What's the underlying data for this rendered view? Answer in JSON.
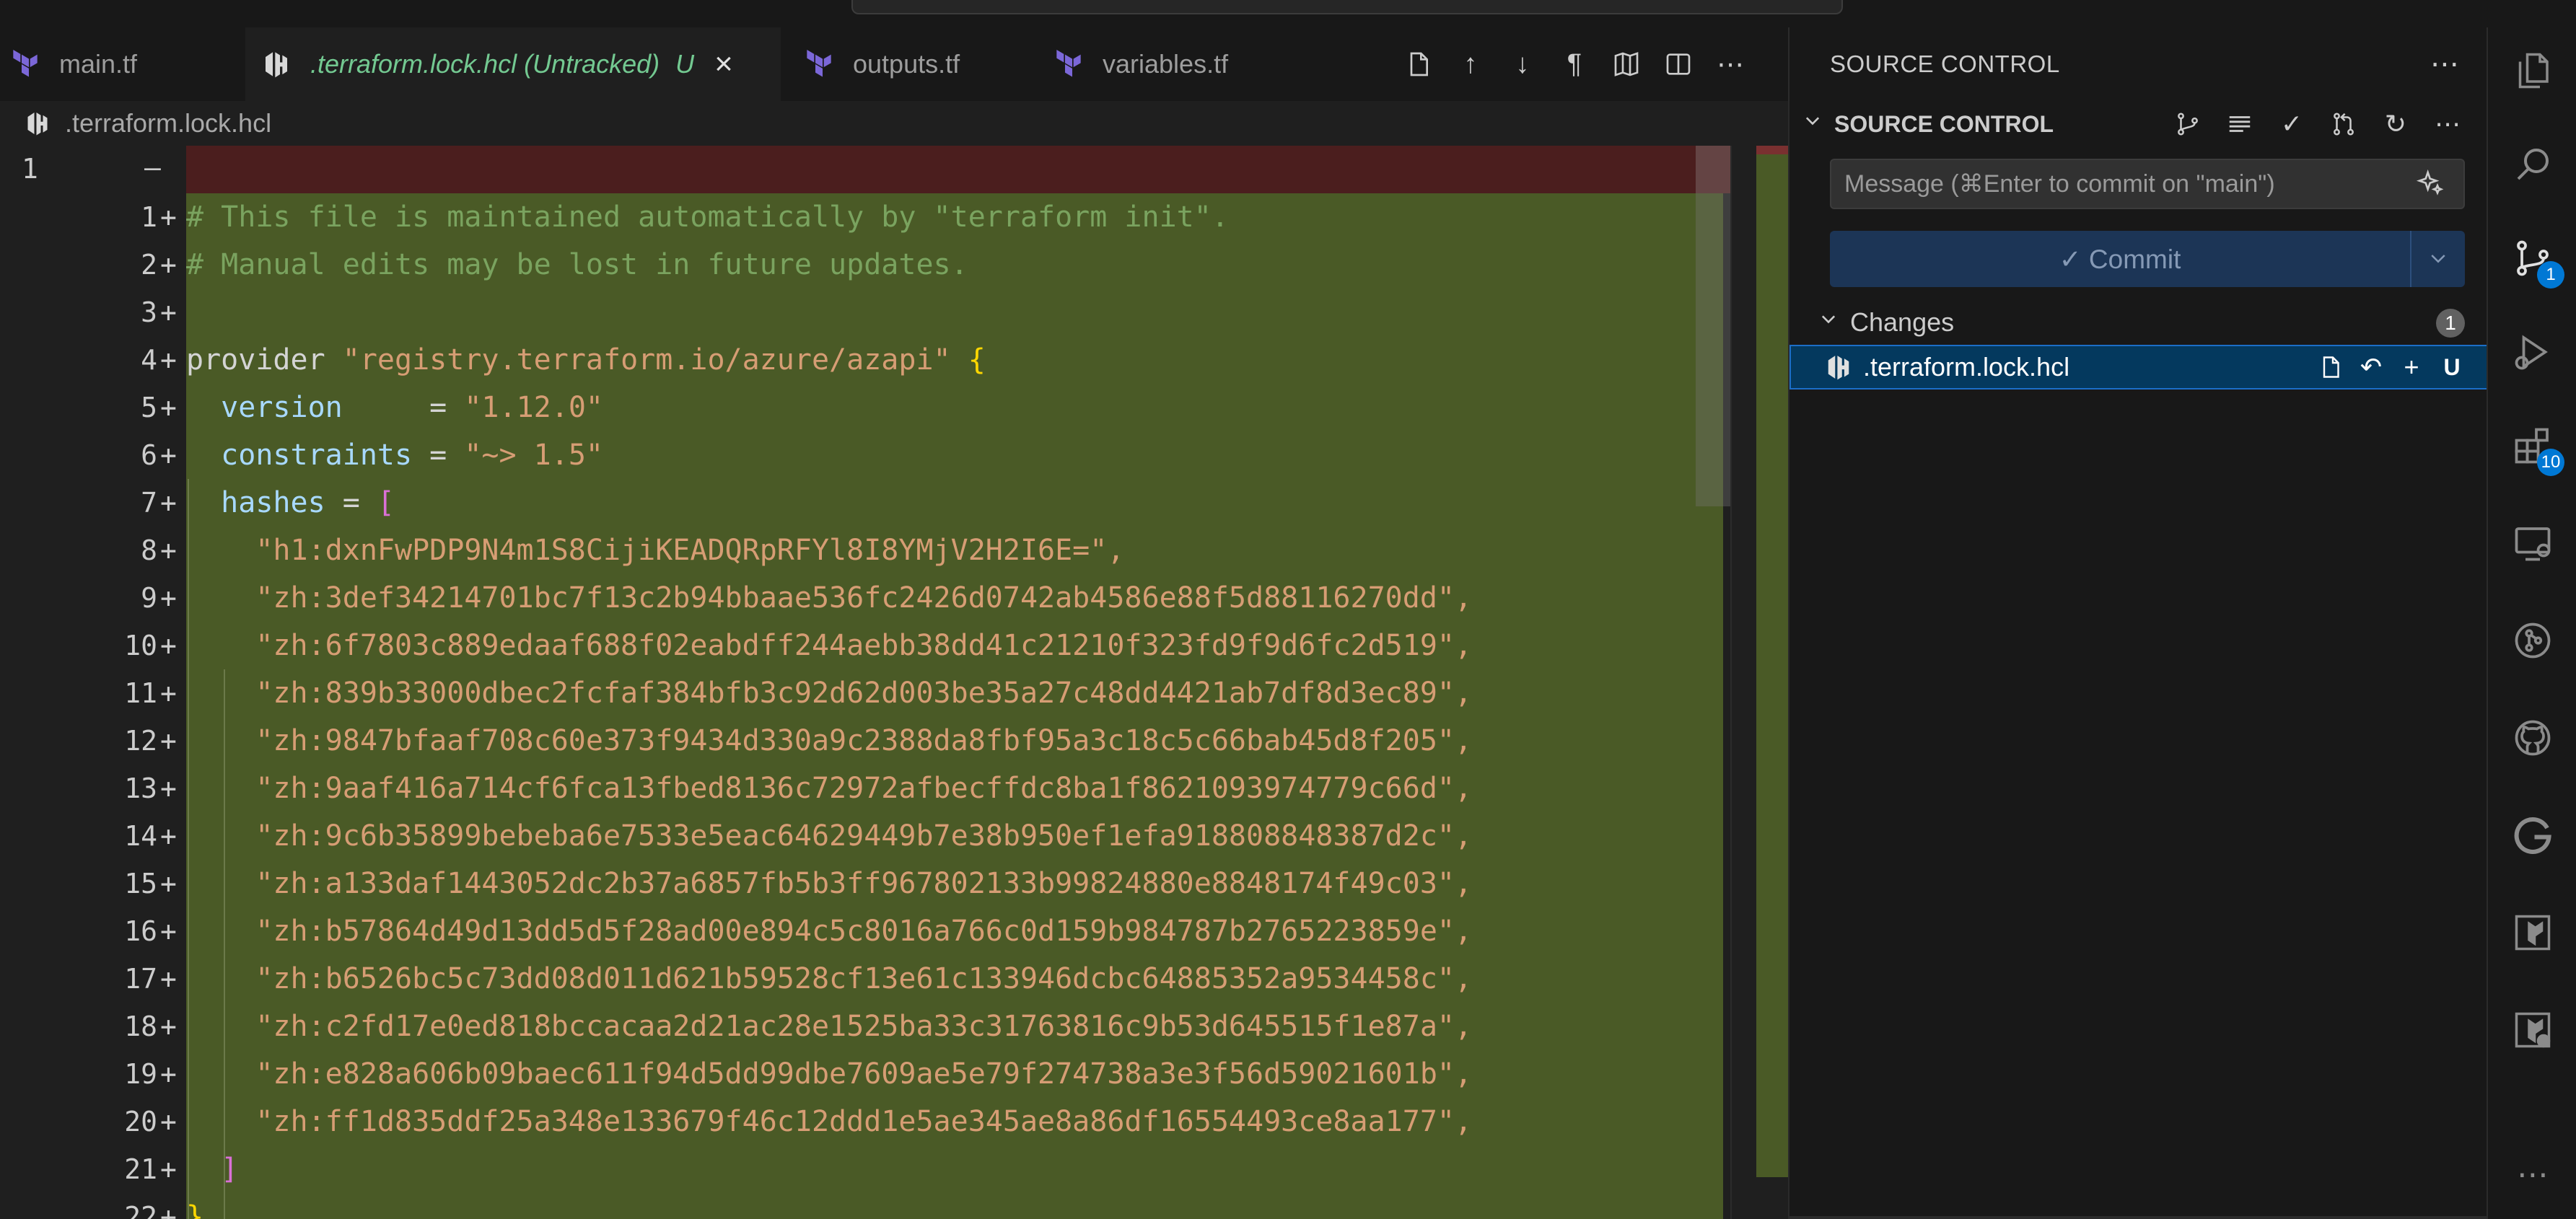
{
  "tabs": [
    {
      "label": "main.tf",
      "icon": "terraform-icon"
    },
    {
      "label": ".terraform.lock.hcl (Untracked)",
      "decoration": "U",
      "icon": "hcl-icon",
      "active": true
    },
    {
      "label": "outputs.tf",
      "icon": "terraform-icon"
    },
    {
      "label": "variables.tf",
      "icon": "terraform-icon"
    }
  ],
  "breadcrumb": {
    "file": ".terraform.lock.hcl"
  },
  "editor": {
    "original_line": "1",
    "removed_marker": "—",
    "line_numbers": [
      "1",
      "2",
      "3",
      "4",
      "5",
      "6",
      "7",
      "8",
      "9",
      "10",
      "11",
      "12",
      "13",
      "14",
      "15",
      "16",
      "17",
      "18",
      "19",
      "20",
      "21",
      "22"
    ],
    "add_sign": "+",
    "lines": {
      "l1": "# This file is maintained automatically by \"terraform init\".",
      "l2": "# Manual edits may be lost in future updates.",
      "l4_kw": "provider",
      "l4_str": "\"registry.terraform.io/azure/azapi\"",
      "l4_brace": "{",
      "l5_attr": "version",
      "l5_eq": "     = ",
      "l5_val": "\"1.12.0\"",
      "l6_attr": "constraints",
      "l6_eq": " = ",
      "l6_val": "\"~> 1.5\"",
      "l7_attr": "hashes",
      "l7_eq": " = ",
      "l7_bracket": "[",
      "hashes": [
        "\"h1:dxnFwPDP9N4m1S8CijiKEADQRpRFYl8I8YMjV2H2I6E=\",",
        "\"zh:3def34214701bc7f13c2b94bbaae536fc2426d0742ab4586e88f5d88116270dd\",",
        "\"zh:6f7803c889edaaf688f02eabdff244aebb38dd41c21210f323fd9f9d6fc2d519\",",
        "\"zh:839b33000dbec2fcfaf384bfb3c92d62d003be35a27c48dd4421ab7df8d3ec89\",",
        "\"zh:9847bfaaf708c60e373f9434d330a9c2388da8fbf95a3c18c5c66bab45d8f205\",",
        "\"zh:9aaf416a714cf6fca13fbed8136c72972afbecffdc8ba1f8621093974779c66d\",",
        "\"zh:9c6b35899bebeba6e7533e5eac64629449b7e38b950ef1efa918808848387d2c\",",
        "\"zh:a133daf1443052dc2b37a6857fb5b3ff967802133b99824880e8848174f49c03\",",
        "\"zh:b57864d49d13dd5d5f28ad00e894c5c8016a766c0d159b984787b2765223859e\",",
        "\"zh:b6526bc5c73dd08d011d621b59528cf13e61c133946dcbc64885352a9534458c\",",
        "\"zh:c2fd17e0ed818bccacaa2d21ac28e1525ba33c31763816c9b53d645515f1e87a\",",
        "\"zh:e828a606b09baec611f94d5dd99dbe7609ae5e79f274738a3e3f56d59021601b\",",
        "\"zh:ff1d835ddf25a348e133679f46c12ddd1e5ae345ae8a86df16554493ce8aa177\","
      ],
      "l21_bracket": "]",
      "l22_brace": "}"
    }
  },
  "source_control": {
    "title": "SOURCE CONTROL",
    "section": "SOURCE CONTROL",
    "message_placeholder": "Message (⌘Enter to commit on \"main\")",
    "commit_label": "✓ Commit",
    "changes_label": "Changes",
    "changes_count": "1",
    "file_name": ".terraform.lock.hcl",
    "file_status": "U"
  },
  "activity_badges": {
    "source_control": "1",
    "extensions": "10"
  },
  "colors": {
    "added_bg": "#4a5a26",
    "removed_bg": "#4b1e1e",
    "accent": "#0078d4",
    "untracked": "#73c991"
  }
}
